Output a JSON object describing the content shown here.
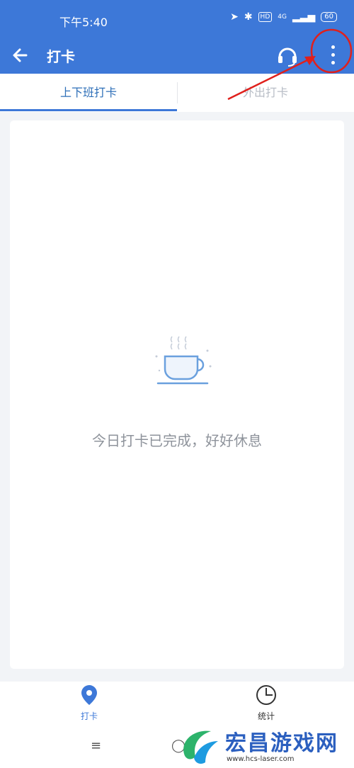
{
  "status_bar": {
    "time": "下午5:40",
    "network": "4G",
    "hd": "HD",
    "battery": "60"
  },
  "app_bar": {
    "title": "打卡"
  },
  "tabs": [
    {
      "label": "上下班打卡"
    },
    {
      "label": "外出打卡"
    }
  ],
  "content": {
    "message": "今日打卡已完成，好好休息"
  },
  "bottom_nav": [
    {
      "label": "打卡"
    },
    {
      "label": "统计"
    }
  ],
  "system_nav": {
    "menu_glyph": "≡",
    "home_glyph": "◯"
  },
  "watermark": {
    "title": "宏昌游戏网",
    "url": "www.hcs-laser.com"
  },
  "colors": {
    "brand_blue": "#3d78d8",
    "annotation_red": "#e0201c"
  }
}
